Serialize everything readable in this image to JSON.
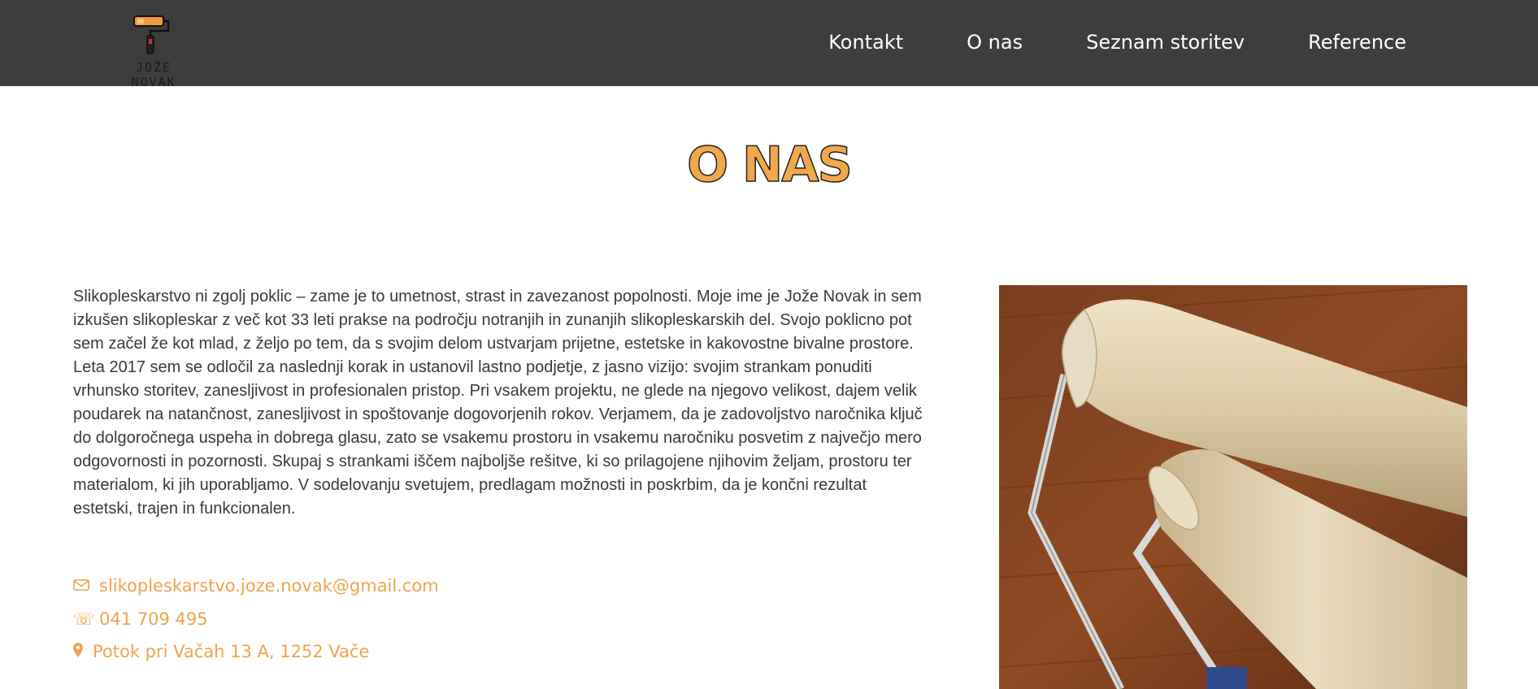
{
  "header": {
    "logo_text": "JOŽE NOVAK",
    "nav": [
      "Kontakt",
      "O nas",
      "Seznam storitev",
      "Reference"
    ]
  },
  "main": {
    "title": "O NAS",
    "paragraph": "Slikopleskarstvo ni zgolj poklic – zame je to umetnost, strast in zavezanost popolnosti. Moje ime je Jože Novak in sem izkušen slikopleskar z več kot 33 leti prakse na področju notranjih in zunanjih slikopleskarskih del. Svojo poklicno pot sem začel že kot mlad, z željo po tem, da s svojim delom ustvarjam prijetne, estetske in kakovostne bivalne prostore. Leta 2017 sem se odločil za naslednji korak in ustanovil lastno podjetje, z jasno vizijo: svojim strankam ponuditi vrhunsko storitev, zanesljivost in profesionalen pristop. Pri vsakem projektu, ne glede na njegovo velikost, dajem velik poudarek na natančnost, zanesljivost in spoštovanje dogovorjenih rokov. Verjamem, da je zadovoljstvo naročnika ključ do dolgoročnega uspeha in dobrega glasu, zato se vsakemu prostoru in vsakemu naročniku posvetim z največjo mero odgovornosti in pozornosti. Skupaj s strankami iščem najboljše rešitve, ki so prilagojene njihovim željam, prostoru ter materialom, ki jih uporabljamo. V sodelovanju svetujem, predlagam možnosti in poskrbim, da je končni rezultat estetski, trajen in funkcionalen.",
    "contact": {
      "email": "slikopleskarstvo.joze.novak@gmail.com",
      "phone": "041 709 495",
      "address": "Potok pri Vačah 13 A, 1252 Vače"
    }
  },
  "icons": {
    "email": "envelope-icon",
    "phone": "phone-icon",
    "address": "map-pin-icon"
  },
  "colors": {
    "navbar": "#3d3d3c",
    "accent": "#f1a84c",
    "text": "#3a3a3a"
  }
}
